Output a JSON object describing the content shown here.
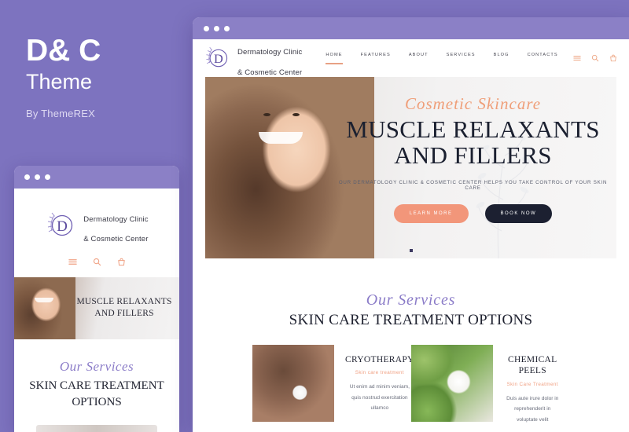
{
  "promo": {
    "title": "D& C",
    "subtitle": "Theme",
    "author": "By ThemeREX"
  },
  "colors": {
    "background_purple": "#7d73bf",
    "titlebar_purple": "#8b80c6",
    "accent_coral": "#f2967a",
    "accent_purple": "#8b7cc8",
    "dark_navy": "#1c2031"
  },
  "desktop": {
    "titlebar": {
      "dots": 3,
      "dot_color": "#ffffff"
    },
    "brand": {
      "logo_letter": "D",
      "name_line1": "Dermatology Clinic",
      "name_line2": "& Cosmetic Center",
      "logo_icon": "laurel-monogram-icon"
    },
    "menu": [
      {
        "label": "HOME",
        "active": true
      },
      {
        "label": "FEATURES",
        "active": false
      },
      {
        "label": "ABOUT",
        "active": false
      },
      {
        "label": "SERVICES",
        "active": false
      },
      {
        "label": "BLOG",
        "active": false
      },
      {
        "label": "CONTACTS",
        "active": false
      }
    ],
    "nav_icons": [
      "hamburger-icon",
      "search-icon",
      "cart-icon"
    ],
    "hero": {
      "script_text": "Cosmetic Skincare",
      "heading_line1": "MUSCLE RELAXANTS",
      "heading_line2": "AND FILLERS",
      "subtitle": "OUR DERMATOLOGY CLINIC & COSMETIC CENTER HELPS YOU TAKE CONTROL OF YOUR SKIN CARE",
      "button_primary": "LEARN MORE",
      "button_secondary": "BOOK NOW",
      "slider_dots": 1
    },
    "services": {
      "script_text": "Our Services",
      "title": "SKIN CARE TREATMENT OPTIONS",
      "cards": [
        {
          "image": "cryotherapy-photo",
          "heading": "CRYOTHERAPY",
          "subheading": "Skin care treatment",
          "text": "Ut enim ad minim veniam, quis nostrud exercitation ullamco"
        },
        {
          "image": "chemical-peels-photo",
          "heading": "CHEMICAL PEELS",
          "subheading": "Skin Care Treatment",
          "text": "Duis aute irure dolor in reprehenderit in voluptate velit"
        }
      ]
    }
  },
  "mobile": {
    "titlebar": {
      "dots": 3
    },
    "brand": {
      "logo_letter": "D",
      "name_line1": "Dermatology Clinic",
      "name_line2": "& Cosmetic Center"
    },
    "icons": [
      "hamburger-icon",
      "search-icon",
      "cart-icon"
    ],
    "hero": {
      "heading_line1": "MUSCLE RELAXANTS",
      "heading_line2": "AND FILLERS"
    },
    "services": {
      "script_text": "Our Services",
      "title": "SKIN CARE TREATMENT OPTIONS"
    }
  }
}
